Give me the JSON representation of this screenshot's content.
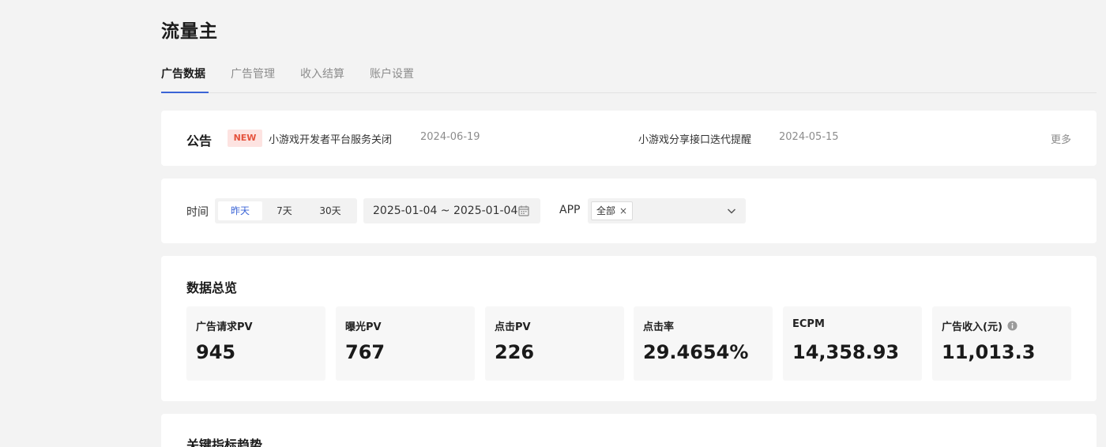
{
  "app": {
    "title": "流量主"
  },
  "tabs": [
    {
      "label": "广告数据",
      "active": true
    },
    {
      "label": "广告管理",
      "active": false
    },
    {
      "label": "收入结算",
      "active": false
    },
    {
      "label": "账户设置",
      "active": false
    }
  ],
  "notices": {
    "title": "公告",
    "badge": "NEW",
    "items": [
      {
        "text": "小游戏开发者平台服务关闭",
        "date": "2024-06-19"
      },
      {
        "text": "小游戏分享接口迭代提醒",
        "date": "2024-05-15"
      }
    ],
    "more_label": "更多"
  },
  "filters": {
    "time_label": "时间",
    "time_options": [
      {
        "label": "昨天",
        "active": true
      },
      {
        "label": "7天",
        "active": false
      },
      {
        "label": "30天",
        "active": false
      }
    ],
    "date_range": "2025-01-04 ~ 2025-01-04",
    "app_label": "APP",
    "app_selected_tag": "全部",
    "tag_close": "×"
  },
  "overview": {
    "title": "数据总览",
    "stats": [
      {
        "label": "广告请求PV",
        "value": "945"
      },
      {
        "label": "曝光PV",
        "value": "767"
      },
      {
        "label": "点击PV",
        "value": "226"
      },
      {
        "label": "点击率",
        "value": "29.4654%"
      },
      {
        "label": "ECPM",
        "value": "14,358.93"
      },
      {
        "label": "广告收入(元)",
        "value": "11,013.3"
      }
    ]
  },
  "trend": {
    "title": "关键指标趋势"
  },
  "colors": {
    "accent": "#3b64d6",
    "new_badge_bg": "#fde3e1",
    "new_badge_text": "#e5533d",
    "page_bg": "#f3f3f3"
  },
  "icons": {
    "calendar": "calendar-icon",
    "chevron": "chevron-down-icon",
    "info": "info-icon"
  }
}
